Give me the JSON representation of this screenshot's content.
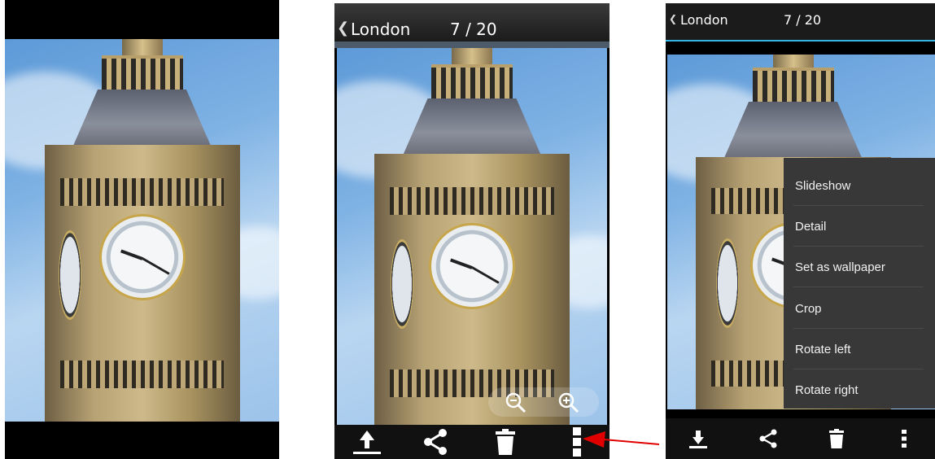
{
  "screen2": {
    "back_glyph": "❮",
    "title": "London",
    "counter": "7 / 20",
    "bottom_icons": [
      "upload-icon",
      "share-icon",
      "trash-icon",
      "overflow-menu-icon"
    ],
    "zoom": [
      "zoom-out-icon",
      "zoom-in-icon"
    ]
  },
  "screen3": {
    "back_glyph": "❮",
    "title": "London",
    "counter": "7 / 20",
    "menu": [
      "Slideshow",
      "Detail",
      "Set as wallpaper",
      "Crop",
      "Rotate left",
      "Rotate right"
    ],
    "bottom_icons": [
      "download-icon",
      "share-icon",
      "trash-icon",
      "overflow-menu-icon"
    ]
  },
  "colors": {
    "accent": "#33b5e5",
    "annotation_arrow": "#e00000",
    "menu_bg": "#383838"
  }
}
